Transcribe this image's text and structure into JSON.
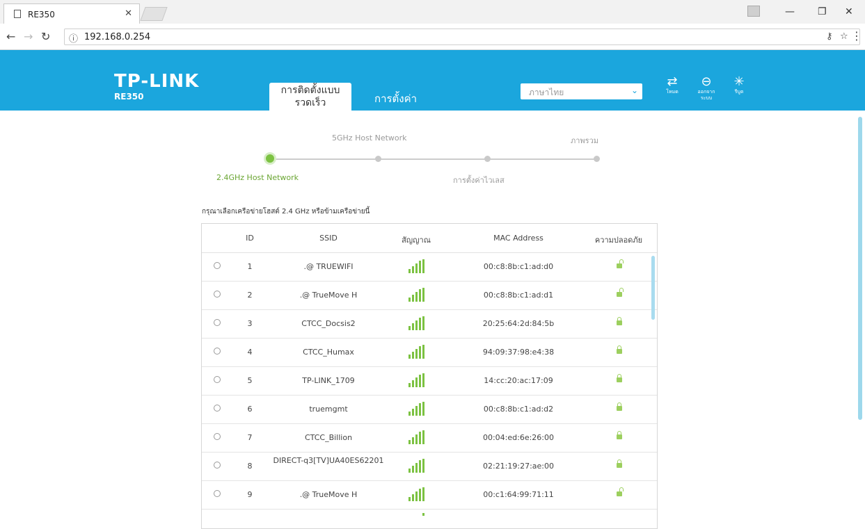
{
  "browser": {
    "tab_title": "RE350",
    "url": "192.168.0.254",
    "info_glyph": "ⓘ"
  },
  "header": {
    "logo": "TP-LINK",
    "model": "RE350",
    "tab_quick_setup": "การติดตั้งแบบรวดเร็ว",
    "tab_settings": "การตั้งค่า",
    "language": "ภาษาไทย",
    "icons": [
      {
        "name": "mode-icon",
        "label": "โหมด"
      },
      {
        "name": "logout-icon",
        "label": "ออกจากระบบ"
      },
      {
        "name": "reboot-icon",
        "label": "รีบูต"
      }
    ],
    "accent_color": "#1ba6dd"
  },
  "stepper": {
    "steps": [
      {
        "label": "2.4GHz Host Network",
        "active": true
      },
      {
        "label": "5GHz Host Network",
        "active": false
      },
      {
        "label": "การตั้งค่าไวเลส",
        "active": false
      },
      {
        "label": "ภาพรวม",
        "active": false
      }
    ],
    "active_color": "#7cc242"
  },
  "instruction": "กรุณาเลือกเครือข่ายโฮสต์ 2.4 GHz หรือข้ามเครือข่ายนี้",
  "table": {
    "headers": [
      "ID",
      "SSID",
      "สัญญาณ",
      "MAC Address",
      "ความปลอดภัย"
    ],
    "rows": [
      {
        "id": "1",
        "ssid": ".@ TRUEWIFI",
        "mac": "00:c8:8b:c1:ad:d0",
        "secured": false
      },
      {
        "id": "2",
        "ssid": ".@ TrueMove H",
        "mac": "00:c8:8b:c1:ad:d1",
        "secured": false
      },
      {
        "id": "3",
        "ssid": "CTCC_Docsis2",
        "mac": "20:25:64:2d:84:5b",
        "secured": true
      },
      {
        "id": "4",
        "ssid": "CTCC_Humax",
        "mac": "94:09:37:98:e4:38",
        "secured": true
      },
      {
        "id": "5",
        "ssid": "TP-LINK_1709",
        "mac": "14:cc:20:ac:17:09",
        "secured": true
      },
      {
        "id": "6",
        "ssid": "truemgmt",
        "mac": "00:c8:8b:c1:ad:d2",
        "secured": true
      },
      {
        "id": "7",
        "ssid": "CTCC_Billion",
        "mac": "00:04:ed:6e:26:00",
        "secured": true
      },
      {
        "id": "8",
        "ssid": "DIRECT-q3[TV]UA40ES62201",
        "mac": "02:21:19:27:ae:00",
        "secured": true
      },
      {
        "id": "9",
        "ssid": ".@ TrueMove H",
        "mac": "00:c1:64:99:71:11",
        "secured": false
      }
    ]
  }
}
